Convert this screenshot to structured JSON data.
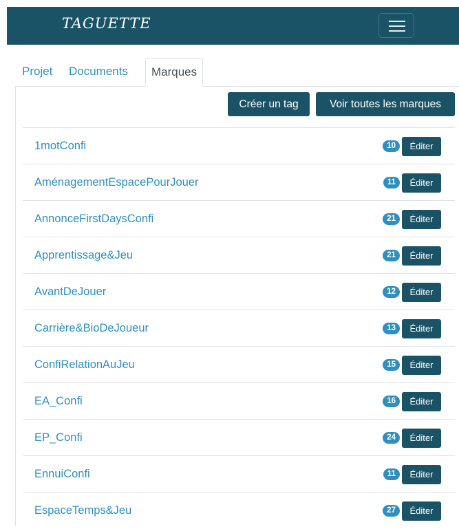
{
  "navbar": {
    "brand": "TAGUETTE",
    "toggler_icon": "hamburger-menu-icon"
  },
  "tabs": [
    {
      "label": "Projet",
      "active": false
    },
    {
      "label": "Documents",
      "active": false
    },
    {
      "label": "Marques",
      "active": true
    }
  ],
  "actions": {
    "create_tag": "Créer un tag",
    "view_all": "Voir toutes les marques"
  },
  "edit_label": "Éditer",
  "colors": {
    "navbar": "#1b5366",
    "link": "#2e8fc0",
    "badge": "#2e8fc0",
    "button": "#1b5366"
  },
  "tags": [
    {
      "name": "1motConfi",
      "count": "10"
    },
    {
      "name": "AménagementEspacePourJouer",
      "count": "11"
    },
    {
      "name": "AnnonceFirstDaysConfi",
      "count": "21"
    },
    {
      "name": "Apprentissage&Jeu",
      "count": "21"
    },
    {
      "name": "AvantDeJouer",
      "count": "12"
    },
    {
      "name": "Carrière&BioDeJoueur",
      "count": "13"
    },
    {
      "name": "ConfiRelationAuJeu",
      "count": "15"
    },
    {
      "name": "EA_Confi",
      "count": "16"
    },
    {
      "name": "EP_Confi",
      "count": "24"
    },
    {
      "name": "EnnuiConfi",
      "count": "11"
    },
    {
      "name": "EspaceTemps&Jeu",
      "count": "27"
    }
  ]
}
